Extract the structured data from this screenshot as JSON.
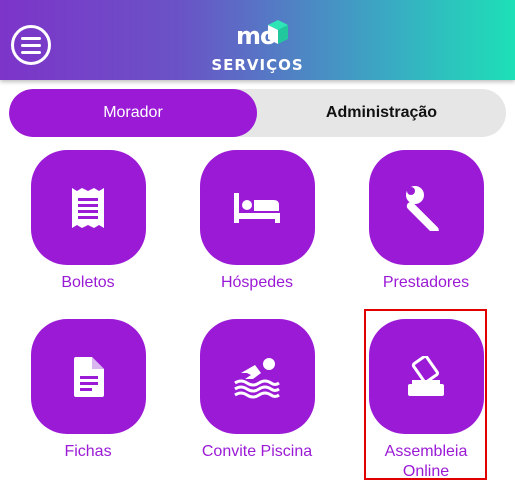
{
  "header": {
    "logo_text": "mo",
    "title": "SERVIÇOS",
    "gradient_start": "#7d34c9",
    "gradient_end": "#1de0b7"
  },
  "tabs": [
    {
      "label": "Morador",
      "active": true
    },
    {
      "label": "Administração",
      "active": false
    }
  ],
  "services": [
    {
      "label": "Boletos",
      "icon": "receipt-icon"
    },
    {
      "label": "Hóspedes",
      "icon": "bed-icon"
    },
    {
      "label": "Prestadores",
      "icon": "wrench-icon"
    },
    {
      "label": "Fichas",
      "icon": "document-icon"
    },
    {
      "label": "Convite Piscina",
      "icon": "swimmer-icon"
    },
    {
      "label": "Assembleia Online",
      "icon": "ballot-box-icon"
    }
  ],
  "colors": {
    "accent": "#9b1ad6",
    "highlight": "#e00000"
  }
}
